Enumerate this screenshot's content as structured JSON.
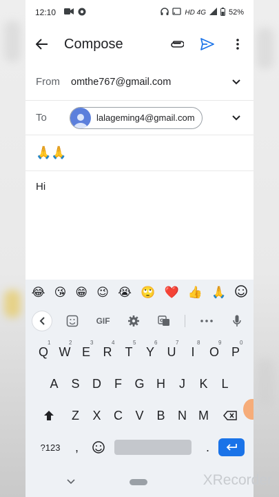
{
  "status_bar": {
    "time": "12:10",
    "network": "HD 4G",
    "battery": "52%"
  },
  "app_bar": {
    "title": "Compose",
    "back_icon": "arrow-back-icon",
    "attach_icon": "paperclip-icon",
    "send_icon": "send-icon",
    "more_icon": "more-vert-icon"
  },
  "compose": {
    "from_label": "From",
    "from_value": "omthe767@gmail.com",
    "to_label": "To",
    "to_chip": "lalageming4@gmail.com",
    "subject": "🙏🙏",
    "body": "Hi"
  },
  "keyboard": {
    "emoji_suggestions": [
      "😂",
      "😘",
      "😁",
      "😉",
      "😭",
      "🙄",
      "❤️",
      "👍",
      "🙏"
    ],
    "toolbar": {
      "gif_label": "GIF"
    },
    "row1": [
      {
        "k": "Q",
        "hint": "1"
      },
      {
        "k": "W",
        "hint": "2"
      },
      {
        "k": "E",
        "hint": "3"
      },
      {
        "k": "R",
        "hint": "4"
      },
      {
        "k": "T",
        "hint": "5"
      },
      {
        "k": "Y",
        "hint": "6"
      },
      {
        "k": "U",
        "hint": "7"
      },
      {
        "k": "I",
        "hint": "8"
      },
      {
        "k": "O",
        "hint": "9"
      },
      {
        "k": "P",
        "hint": "0"
      }
    ],
    "row2": [
      "A",
      "S",
      "D",
      "F",
      "G",
      "H",
      "J",
      "K",
      "L"
    ],
    "row3": [
      "Z",
      "X",
      "C",
      "V",
      "B",
      "N",
      "M"
    ],
    "row4": {
      "symbols": "?123",
      "comma": ",",
      "period": "."
    }
  },
  "watermark": "XRecorder",
  "colors": {
    "accent": "#1a73e8",
    "send": "#1a73e8"
  }
}
